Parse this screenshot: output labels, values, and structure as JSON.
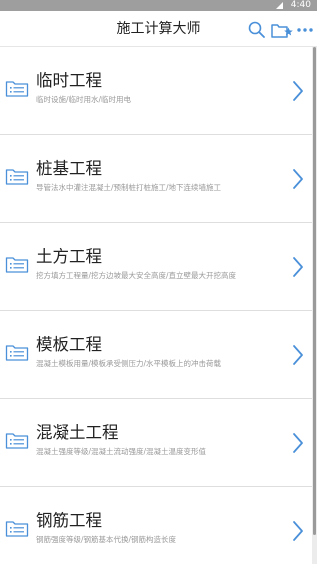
{
  "status_bar": {
    "time": "4:40"
  },
  "app_bar": {
    "title": "施工计算大师"
  },
  "colors": {
    "accent": "#4a90d9",
    "status_bar": "#9e9e9e",
    "divider": "#dedede"
  },
  "items": [
    {
      "title": "临时工程",
      "subtitle": "临时设施/临时用水/临时用电"
    },
    {
      "title": "桩基工程",
      "subtitle": "导管法水中灌注混凝土/预制桩打桩施工/地下连续墙施工"
    },
    {
      "title": "土方工程",
      "subtitle": "挖方填方工程量/挖方边坡最大安全高度/直立壁最大开挖高度"
    },
    {
      "title": "模板工程",
      "subtitle": "混凝土模板用量/模板承受侧压力/水平模板上的冲击荷载"
    },
    {
      "title": "混凝土工程",
      "subtitle": "混凝土强度等级/混凝土流动强度/混凝土温度变形值"
    },
    {
      "title": "钢筋工程",
      "subtitle": "钢筋强度等级/钢筋基本代换/钢筋构造长度"
    }
  ]
}
